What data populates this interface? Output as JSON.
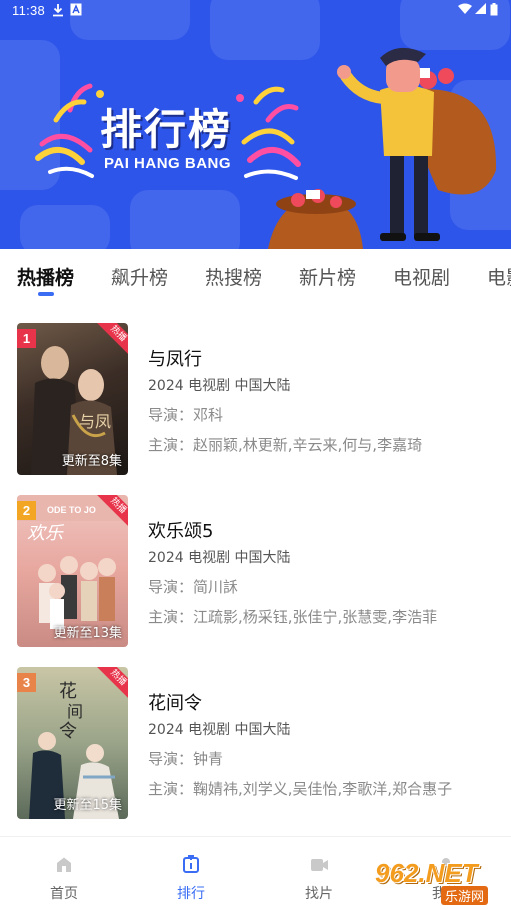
{
  "status_bar": {
    "time": "11:38",
    "icons": [
      "download-icon",
      "a-notification-icon",
      "wifi-icon",
      "signal-icon",
      "battery-icon"
    ]
  },
  "banner": {
    "title": "排行榜",
    "subtitle": "PAI HANG BANG",
    "background_color": "#2d55ea"
  },
  "tabs": [
    {
      "label": "热播榜",
      "active": true
    },
    {
      "label": "飙升榜",
      "active": false
    },
    {
      "label": "热搜榜",
      "active": false
    },
    {
      "label": "新片榜",
      "active": false
    },
    {
      "label": "电视剧",
      "active": false
    },
    {
      "label": "电影",
      "active": false
    }
  ],
  "accent_color": "#3a6cf4",
  "list": [
    {
      "rank": "1",
      "rank_color": "#e8344a",
      "hot_tag": "热播",
      "update": "更新至8集",
      "title": "与凤行",
      "meta": "2024  电视剧  中国大陆",
      "director": "导演：邓科",
      "cast": "主演：赵丽颖,林更新,辛云来,何与,李嘉琦"
    },
    {
      "rank": "2",
      "rank_color": "#f2a623",
      "hot_tag": "热播",
      "update": "更新至13集",
      "title": "欢乐颂5",
      "meta": "2024  电视剧  中国大陆",
      "director": "导演：简川訸",
      "cast": "主演：江疏影,杨采钰,张佳宁,张慧雯,李浩菲"
    },
    {
      "rank": "3",
      "rank_color": "#e8844a",
      "hot_tag": "热播",
      "update": "更新至15集",
      "title": "花间令",
      "meta": "2024  电视剧  中国大陆",
      "director": "导演：钟青",
      "cast": "主演：鞠婧祎,刘学义,吴佳怡,李歌洋,郑合惠子"
    }
  ],
  "bottom_nav": [
    {
      "label": "首页",
      "icon": "home-icon",
      "active": false
    },
    {
      "label": "排行",
      "icon": "ranking-icon",
      "active": true
    },
    {
      "label": "找片",
      "icon": "video-icon",
      "active": false
    },
    {
      "label": "我的",
      "icon": "profile-icon",
      "active": false
    }
  ],
  "watermark": {
    "main": "962.NET",
    "sub": "乐游网"
  }
}
